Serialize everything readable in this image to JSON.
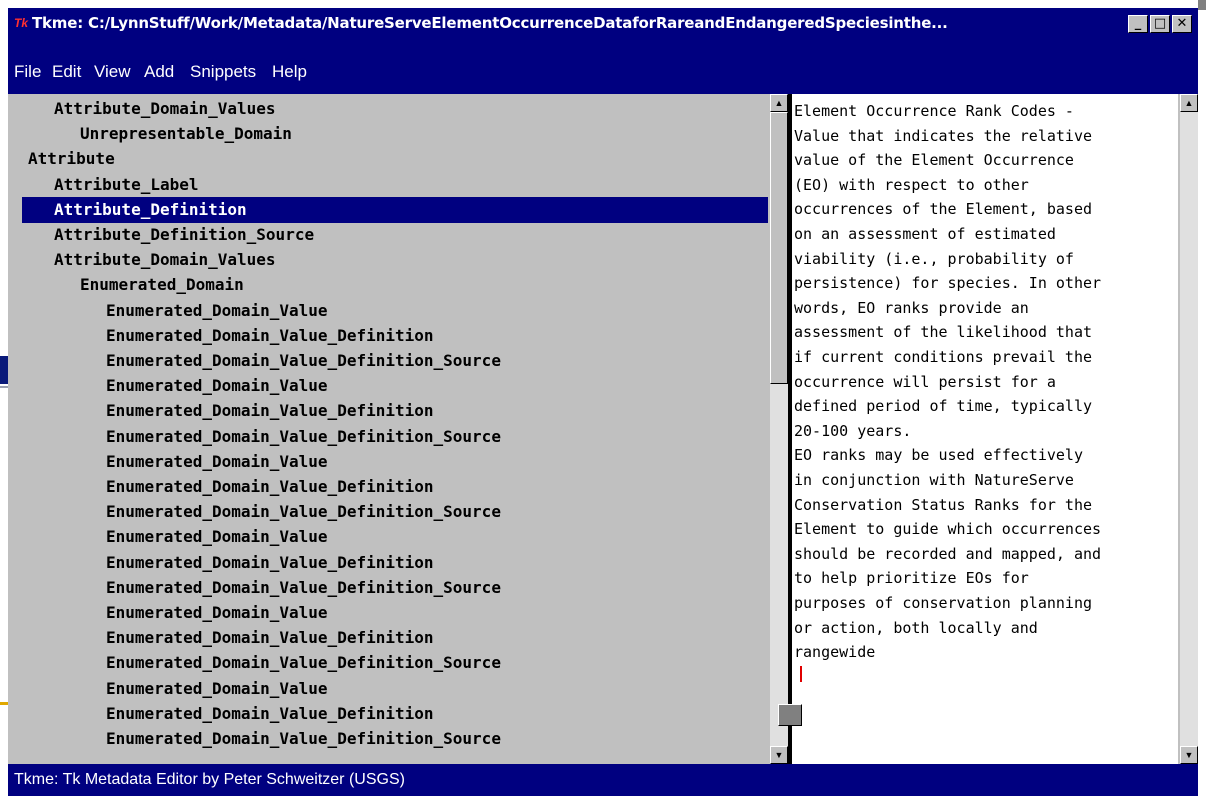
{
  "window": {
    "title": "Tkme: C:/LynnStuff/Work/Metadata/NatureServeElementOccurrenceDataforRareandEndangeredSpeciesinthe...",
    "app_icon": "Tk",
    "minimize_glyph": "_",
    "maximize_glyph": "□",
    "close_glyph": "✕"
  },
  "menu": {
    "file": "File",
    "edit": "Edit",
    "view": "View",
    "add": "Add",
    "snippets": "Snippets",
    "help": "Help"
  },
  "tree": {
    "selected_index": 4,
    "rows": [
      {
        "text": "Attribute_Domain_Values",
        "level": 2
      },
      {
        "text": "Unrepresentable_Domain",
        "level": 3
      },
      {
        "text": "Attribute",
        "level": 1
      },
      {
        "text": "Attribute_Label",
        "level": 2
      },
      {
        "text": "Attribute_Definition",
        "level": 2
      },
      {
        "text": "Attribute_Definition_Source",
        "level": 2
      },
      {
        "text": "Attribute_Domain_Values",
        "level": 2
      },
      {
        "text": "Enumerated_Domain",
        "level": 3
      },
      {
        "text": "Enumerated_Domain_Value",
        "level": 4
      },
      {
        "text": "Enumerated_Domain_Value_Definition",
        "level": 4
      },
      {
        "text": "Enumerated_Domain_Value_Definition_Source",
        "level": 4
      },
      {
        "text": "Enumerated_Domain_Value",
        "level": 4
      },
      {
        "text": "Enumerated_Domain_Value_Definition",
        "level": 4
      },
      {
        "text": "Enumerated_Domain_Value_Definition_Source",
        "level": 4
      },
      {
        "text": "Enumerated_Domain_Value",
        "level": 4
      },
      {
        "text": "Enumerated_Domain_Value_Definition",
        "level": 4
      },
      {
        "text": "Enumerated_Domain_Value_Definition_Source",
        "level": 4
      },
      {
        "text": "Enumerated_Domain_Value",
        "level": 4
      },
      {
        "text": "Enumerated_Domain_Value_Definition",
        "level": 4
      },
      {
        "text": "Enumerated_Domain_Value_Definition_Source",
        "level": 4
      },
      {
        "text": "Enumerated_Domain_Value",
        "level": 4
      },
      {
        "text": "Enumerated_Domain_Value_Definition",
        "level": 4
      },
      {
        "text": "Enumerated_Domain_Value_Definition_Source",
        "level": 4
      },
      {
        "text": "Enumerated_Domain_Value",
        "level": 4
      },
      {
        "text": "Enumerated_Domain_Value_Definition",
        "level": 4
      },
      {
        "text": "Enumerated_Domain_Value_Definition_Source",
        "level": 4
      }
    ]
  },
  "detail": {
    "lines": [
      "Element Occurrence Rank Codes -",
      "Value that indicates the relative",
      "value of the Element Occurrence",
      "(EO) with respect to other",
      "occurrences of the Element, based",
      "on an assessment of estimated",
      "viability (i.e., probability of",
      "persistence) for species. In other",
      "words, EO ranks provide an",
      "assessment of the likelihood that",
      "if current conditions prevail the",
      "occurrence will persist for a",
      "defined period of time, typically",
      "20-100 years.",
      "EO ranks may be used effectively",
      "in conjunction with NatureServe",
      "Conservation Status Ranks for the",
      "Element to guide which occurrences",
      "should be recorded and mapped, and",
      "to help prioritize EOs for",
      "purposes of conservation planning",
      "or action, both locally and",
      "rangewide"
    ]
  },
  "scrollbars": {
    "up_glyph": "▲",
    "down_glyph": "▼"
  },
  "status": "Tkme: Tk Metadata Editor by Peter Schweitzer (USGS)",
  "colors": {
    "title_bar": "#000080",
    "face": "#c0c0c0",
    "selection": "#000080"
  }
}
